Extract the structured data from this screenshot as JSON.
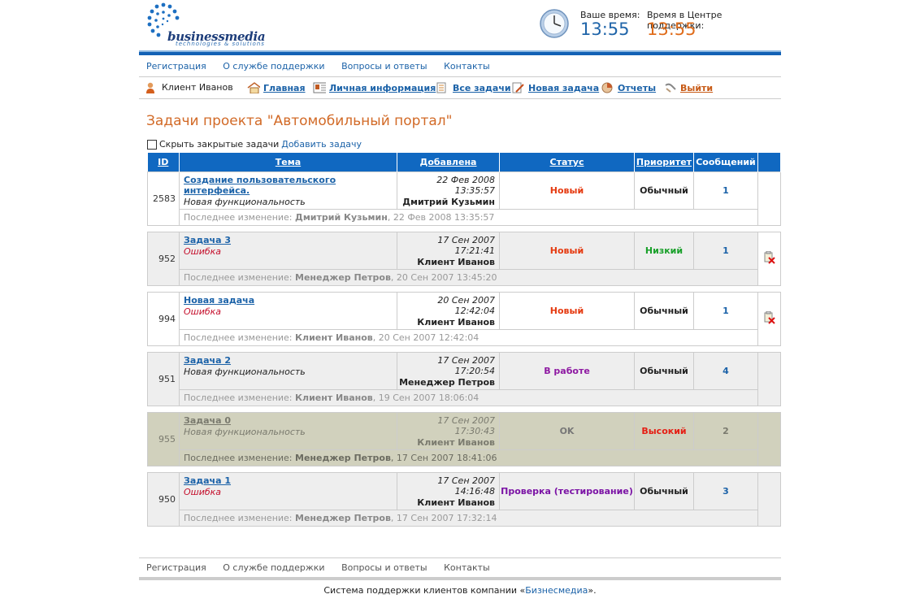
{
  "header": {
    "logo_brand": "businessmedia",
    "logo_sub": "technologies & solutions",
    "local_time_label": "Ваше время:",
    "local_time": "13:55",
    "support_time_label": "Время в Центре поддержки:",
    "support_time": "13:55"
  },
  "topnav": [
    "Регистрация",
    "О службе поддержки",
    "Вопросы и ответы",
    "Контакты"
  ],
  "usernav": {
    "user": "Клиент Иванов",
    "home": "Главная",
    "profile": "Личная информация",
    "all_tasks": "Все задачи",
    "new_task": "Новая задача",
    "reports": "Отчеты",
    "logout": "Выйти"
  },
  "page_title": "Задачи проекта \"Автомобильный портал\"",
  "controls": {
    "hide_closed": "Скрыть закрытые задачи",
    "add_task": "Добавить задачу"
  },
  "table": {
    "headers": [
      "ID",
      "Тема",
      "Добавлена",
      "Статус",
      "Приоритет",
      "Сообщений"
    ],
    "last_change_label": "Последнее изменение:",
    "rows": [
      {
        "id": "2583",
        "title": "Создание пользовательского интерфейса.",
        "kind": "Новая функциональность",
        "date": "22 Фев 2008 13:35:57",
        "author": "Дмитрий Кузьмин",
        "status": "Новый",
        "priority": "Обычный",
        "messages": "1",
        "last_by": "Дмитрий Кузьмин",
        "last_date": ", 22 Фев 2008 13:35:57"
      },
      {
        "id": "952",
        "title": "Задача 3",
        "kind": "Ошибка",
        "date": "17 Сен 2007 17:21:41",
        "author": "Клиент Иванов",
        "status": "Новый",
        "priority": "Низкий",
        "messages": "1",
        "last_by": "Менеджер Петров",
        "last_date": ", 20 Сен 2007 13:45:20"
      },
      {
        "id": "994",
        "title": "Новая задача",
        "kind": "Ошибка",
        "date": "20 Сен 2007 12:42:04",
        "author": "Клиент Иванов",
        "status": "Новый",
        "priority": "Обычный",
        "messages": "1",
        "last_by": "Клиент Иванов",
        "last_date": ", 20 Сен 2007 12:42:04"
      },
      {
        "id": "951",
        "title": "Задача 2",
        "kind": "Новая функциональность",
        "date": "17 Сен 2007 17:20:54",
        "author": "Менеджер Петров",
        "status": "В работе",
        "priority": "Обычный",
        "messages": "4",
        "last_by": "Клиент Иванов",
        "last_date": ", 19 Сен 2007 18:06:04"
      },
      {
        "id": "955",
        "title": "Задача 0",
        "kind": "Новая функциональность",
        "date": "17 Сен 2007 17:30:43",
        "author": "Клиент Иванов",
        "status": "OK",
        "priority": "Высокий",
        "messages": "2",
        "last_by": "Менеджер Петров",
        "last_date": ", 17 Сен 2007 18:41:06"
      },
      {
        "id": "950",
        "title": "Задача 1",
        "kind": "Ошибка",
        "date": "17 Сен 2007 14:16:48",
        "author": "Клиент Иванов",
        "status": "Проверка (тестирование)",
        "priority": "Обычный",
        "messages": "3",
        "last_by": "Менеджер Петров",
        "last_date": ", 17 Сен 2007 17:32:14"
      }
    ]
  },
  "footer": {
    "nav": [
      "Регистрация",
      "О службе поддержки",
      "Вопросы и ответы",
      "Контакты"
    ],
    "copy_prefix": "Система поддержки клиентов компании «",
    "copy_link": "Бизнесмедиа",
    "copy_suffix": "»."
  }
}
